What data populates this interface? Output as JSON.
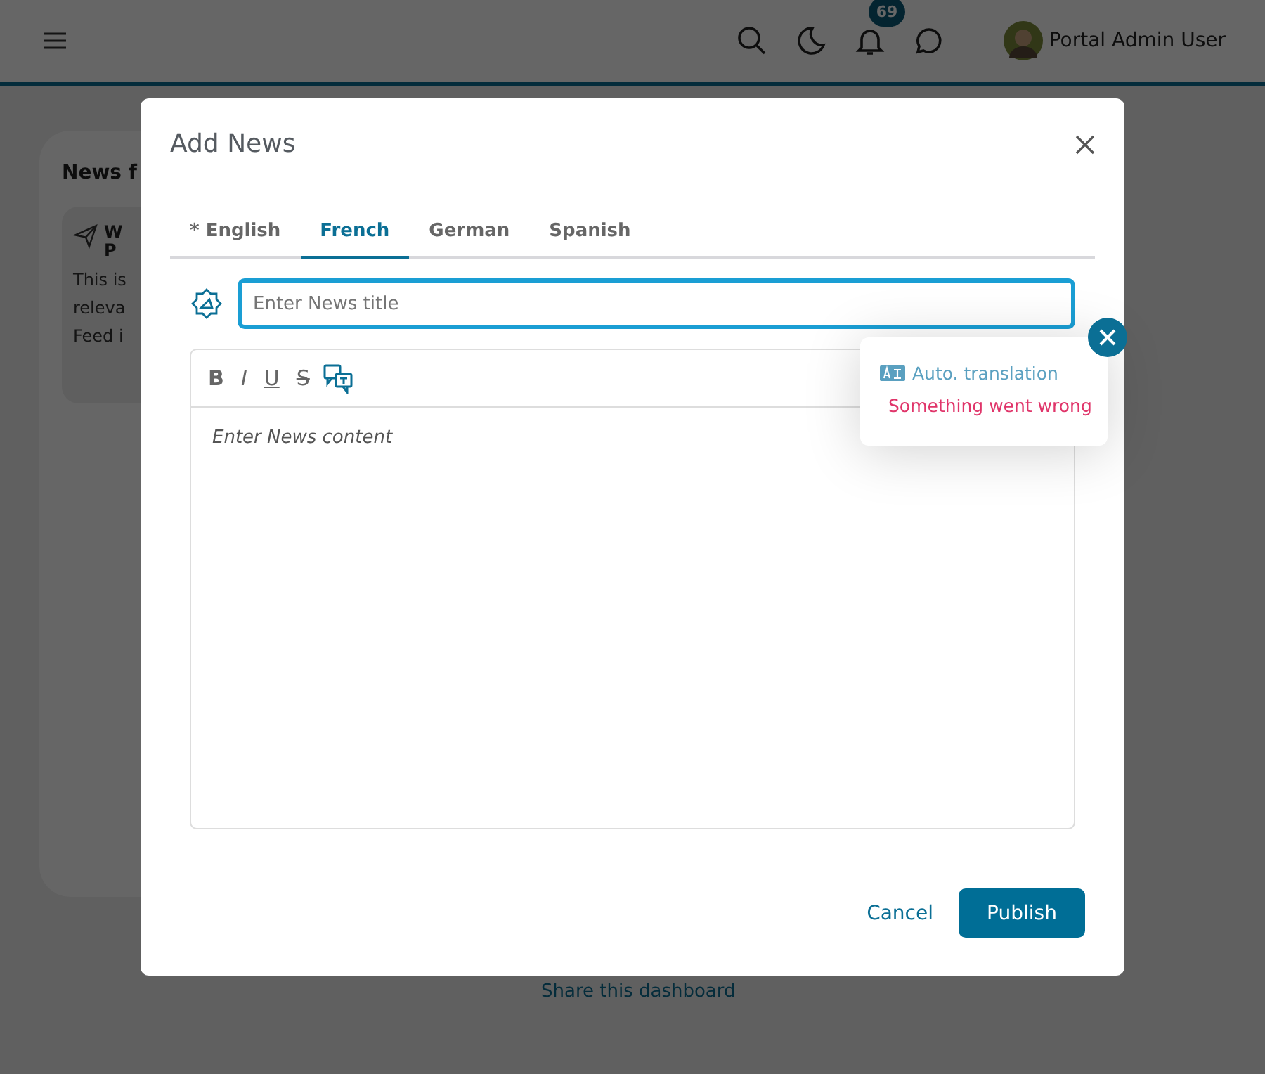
{
  "header": {
    "user_name": "Portal Admin User",
    "notification_count": "69"
  },
  "background_card": {
    "title": "News f",
    "item_title_lines": [
      "W",
      "P"
    ],
    "item_text_lines": [
      "This is",
      "releva",
      "Feed i"
    ],
    "share_link": "Share this dashboard"
  },
  "dialog": {
    "title": "Add News",
    "tabs": [
      {
        "label": "* English",
        "selected": false
      },
      {
        "label": "French",
        "selected": true
      },
      {
        "label": "German",
        "selected": false
      },
      {
        "label": "Spanish",
        "selected": false
      }
    ],
    "title_field": {
      "placeholder": "Enter News title",
      "focused": true
    },
    "editor": {
      "placeholder": "Enter News content",
      "tools": [
        {
          "kind": "bold",
          "label": "B"
        },
        {
          "kind": "italic",
          "label": "I"
        },
        {
          "kind": "underline",
          "label": "U"
        },
        {
          "kind": "strike",
          "label": "S"
        },
        {
          "kind": "translate"
        }
      ]
    },
    "popup": {
      "title": "Auto. translation",
      "error": "Something went wrong"
    },
    "buttons": {
      "cancel": "Cancel",
      "publish": "Publish"
    }
  }
}
